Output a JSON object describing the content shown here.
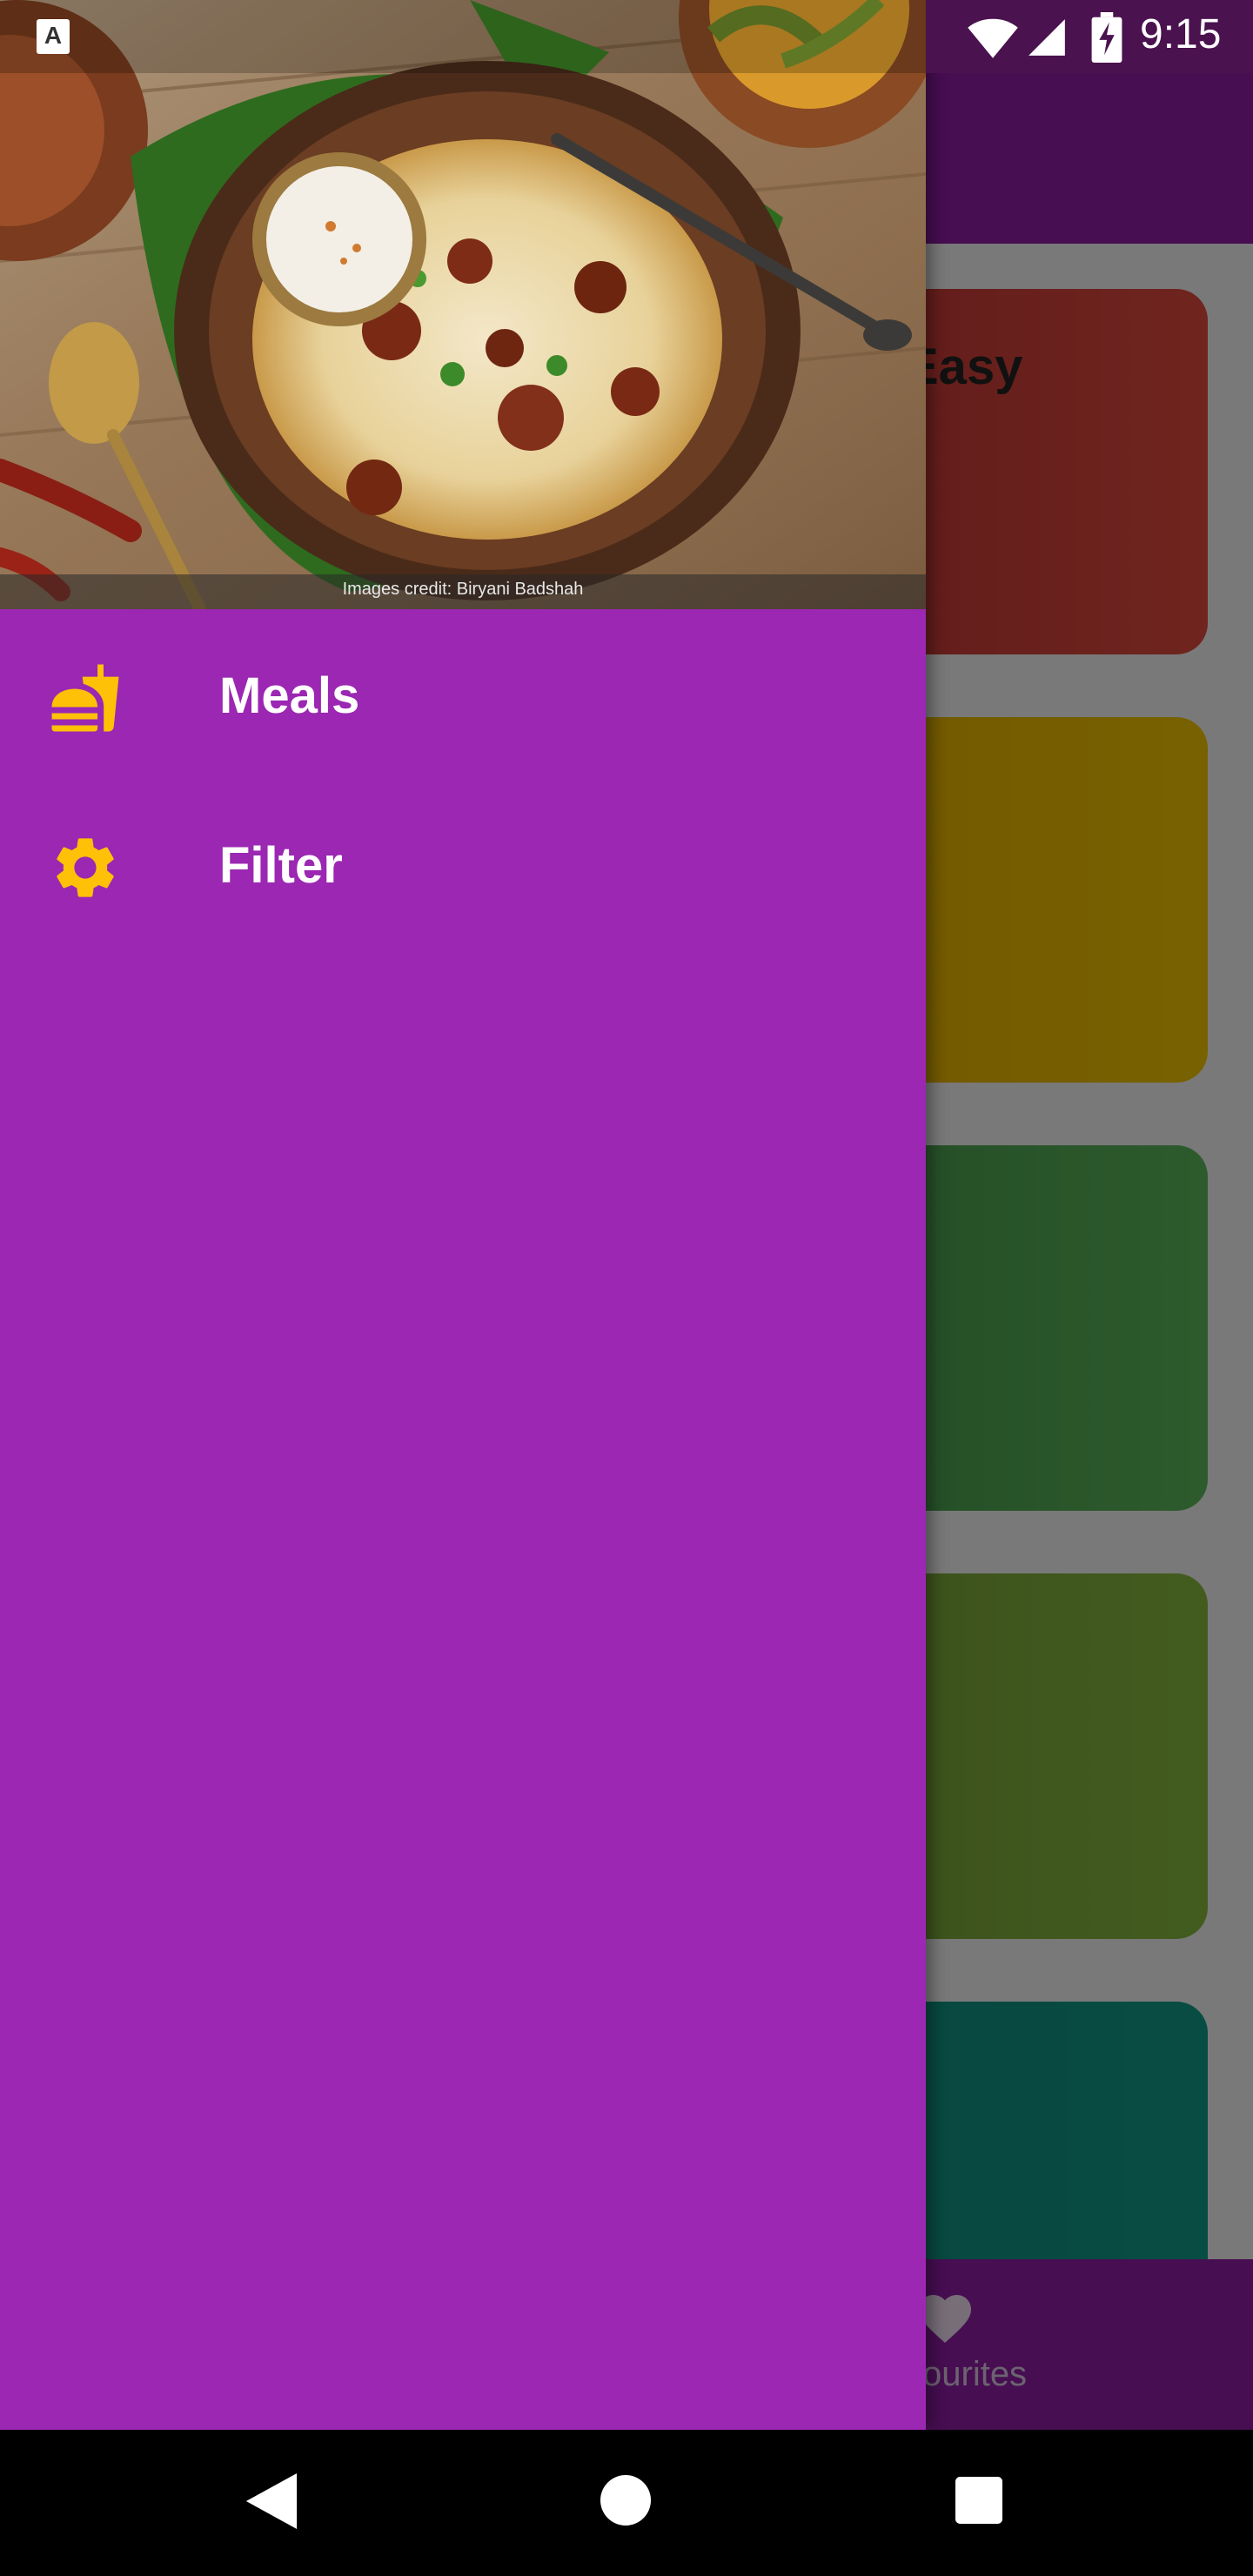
{
  "status_bar": {
    "time": "9:15",
    "notification_glyph": "A",
    "icons": [
      "app-notification-icon",
      "wifi-icon",
      "cell-signal-icon",
      "battery-charging-icon"
    ]
  },
  "drawer": {
    "header_image": "biryani-plate-photo",
    "image_credit": "Images credit: Biryani Badshah",
    "items": [
      {
        "label": "Meals",
        "icon": "fastfood-icon"
      },
      {
        "label": "Filter",
        "icon": "gear-icon"
      }
    ]
  },
  "background_screen": {
    "first_card_title_fragment": "Easy",
    "bottom_nav_label_fragment": "ourites",
    "bottom_nav_icon": "heart-icon"
  },
  "nav_bar": {
    "buttons": [
      "back-icon",
      "home-icon",
      "recents-icon"
    ]
  },
  "colors": {
    "drawer_bg": "#9b27b2",
    "drawer_icon": "#ffc107",
    "app_bar": "#8e1ca4",
    "card_red": "#e04a3e",
    "card_yellow": "#f0c400",
    "card_green": "#5bb75a",
    "card_lime": "#86b83d",
    "card_teal": "#119a88"
  }
}
